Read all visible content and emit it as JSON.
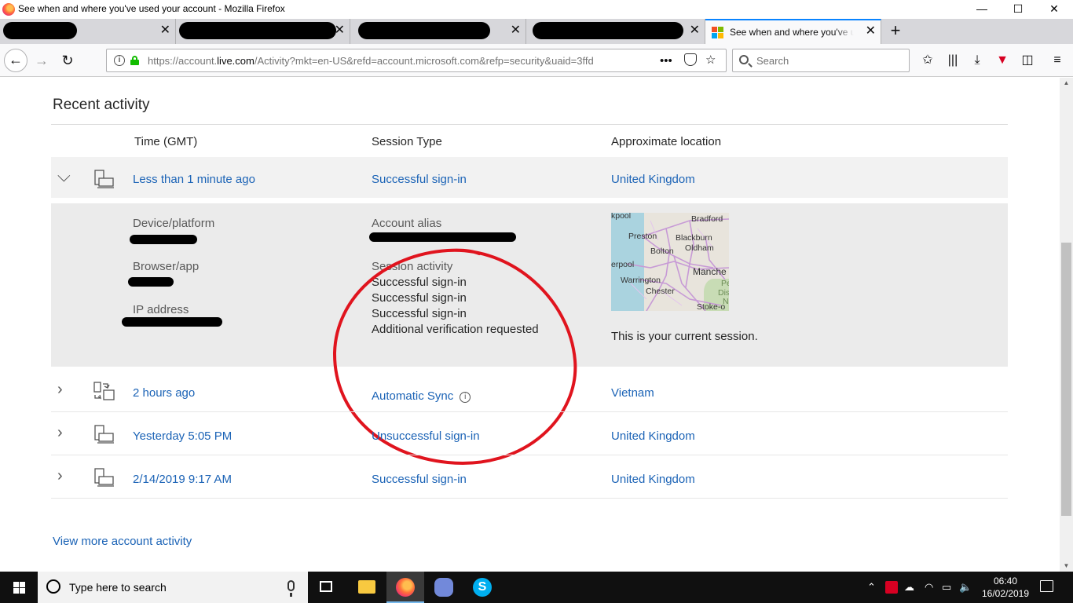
{
  "window": {
    "title": "See when and where you've used your account - Mozilla Firefox",
    "controls": {
      "minimize": "—",
      "maximize": "☐",
      "close": "✕"
    }
  },
  "tabs": [
    {
      "label": "",
      "redacted": true
    },
    {
      "label": "",
      "redacted": true
    },
    {
      "label": "",
      "redacted": true
    },
    {
      "label": "",
      "redacted": true
    },
    {
      "label": "See when and where you've used your account",
      "active": true
    }
  ],
  "toolbar": {
    "url_prefix": "https://account.",
    "url_domain": "live.com",
    "url_rest": "/Activity?mkt=en-US&refd=account.microsoft.com&refp=security&uaid=3ffd",
    "page_actions": "•••",
    "search_placeholder": "Search"
  },
  "page": {
    "section_title": "Recent activity",
    "columns": {
      "time": "Time (GMT)",
      "session_type": "Session Type",
      "location": "Approximate location"
    },
    "rows": [
      {
        "time": "Less than 1 minute ago",
        "session": "Successful sign-in",
        "location": "United Kingdom",
        "expanded": true
      },
      {
        "time": "2 hours ago",
        "session": "Automatic Sync",
        "location": "Vietnam",
        "info": "i"
      },
      {
        "time": "Yesterday 5:05 PM",
        "session": "Unsuccessful sign-in",
        "location": "United Kingdom"
      },
      {
        "time": "2/14/2019 9:17 AM",
        "session": "Successful sign-in",
        "location": "United Kingdom"
      }
    ],
    "detail": {
      "device_label": "Device/platform",
      "browser_label": "Browser/app",
      "ip_label": "IP address",
      "alias_label": "Account alias",
      "session_activity_label": "Session activity",
      "session_activity": [
        "Successful sign-in",
        "Successful sign-in",
        "Successful sign-in",
        "Additional verification requested"
      ],
      "current_session": "This is your current session.",
      "map_labels": {
        "kpool": "kpool",
        "bradford": "Bradford",
        "preston": "Preston",
        "blackburn": "Blackburn",
        "bolton": "Bolton",
        "oldham": "Oldham",
        "erpool": "erpool",
        "manche": "Manche",
        "warrington": "Warrington",
        "chester": "Chester",
        "stoke": "Stoke-o",
        "pe": "Pe",
        "dis": "Dis",
        "n": "N"
      }
    },
    "more_link": "View more account activity"
  },
  "taskbar": {
    "search_placeholder": "Type here to search",
    "time": "06:40",
    "date": "16/02/2019"
  },
  "colors": {
    "link": "#1b63b6",
    "annotation": "#e0141e",
    "firefox_accent": "#0a84ff"
  }
}
